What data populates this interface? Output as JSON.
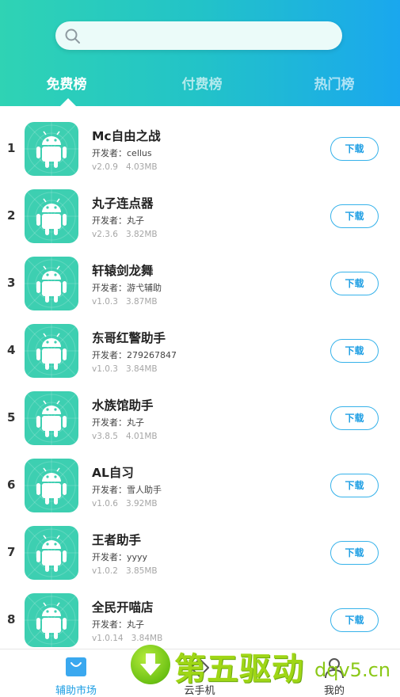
{
  "search": {
    "value": "",
    "placeholder": ""
  },
  "tabs": [
    {
      "label": "免费榜",
      "active": true
    },
    {
      "label": "付费榜",
      "active": false
    },
    {
      "label": "热门榜",
      "active": false
    }
  ],
  "colors": {
    "header_gradient_start": "#2fd3b4",
    "header_gradient_end": "#1aa7ee",
    "app_icon_bg": "#3dcfb1",
    "accent_blue": "#1f9fe4"
  },
  "apps": [
    {
      "rank": "1",
      "name": "Mc自由之战",
      "developer": "开发者：cellus",
      "version": "v2.0.9",
      "size": "4.03MB",
      "button": "下载",
      "icon": "android-icon"
    },
    {
      "rank": "2",
      "name": "丸子连点器",
      "developer": "开发者：丸子",
      "version": "v2.3.6",
      "size": "3.82MB",
      "button": "下载",
      "icon": "android-icon"
    },
    {
      "rank": "3",
      "name": "轩辕剑龙舞",
      "developer": "开发者：游弋辅助",
      "version": "v1.0.3",
      "size": "3.87MB",
      "button": "下载",
      "icon": "android-icon"
    },
    {
      "rank": "4",
      "name": "东哥红警助手",
      "developer": "开发者：279267847",
      "version": "v1.0.3",
      "size": "3.84MB",
      "button": "下载",
      "icon": "android-icon"
    },
    {
      "rank": "5",
      "name": "水族馆助手",
      "developer": "开发者：丸子",
      "version": "v3.8.5",
      "size": "4.01MB",
      "button": "下载",
      "icon": "android-icon"
    },
    {
      "rank": "6",
      "name": "AL自习",
      "developer": "开发者：雪人助手",
      "version": "v1.0.6",
      "size": "3.92MB",
      "button": "下载",
      "icon": "android-icon"
    },
    {
      "rank": "7",
      "name": "王者助手",
      "developer": "开发者：yyyy",
      "version": "v1.0.2",
      "size": "3.85MB",
      "button": "下载",
      "icon": "android-icon"
    },
    {
      "rank": "8",
      "name": "全民开喵店",
      "developer": "开发者：丸子",
      "version": "v1.0.14",
      "size": "3.84MB",
      "button": "下载",
      "icon": "android-icon"
    }
  ],
  "bottom_nav": [
    {
      "label": "辅助市场",
      "icon": "shopping-bag-icon",
      "active": true
    },
    {
      "label": "云手机",
      "icon": "diamond-icon",
      "active": false
    },
    {
      "label": "我的",
      "icon": "person-icon",
      "active": false
    }
  ],
  "watermark": {
    "text": "第五驱动",
    "domain": "dqv5.cn"
  }
}
